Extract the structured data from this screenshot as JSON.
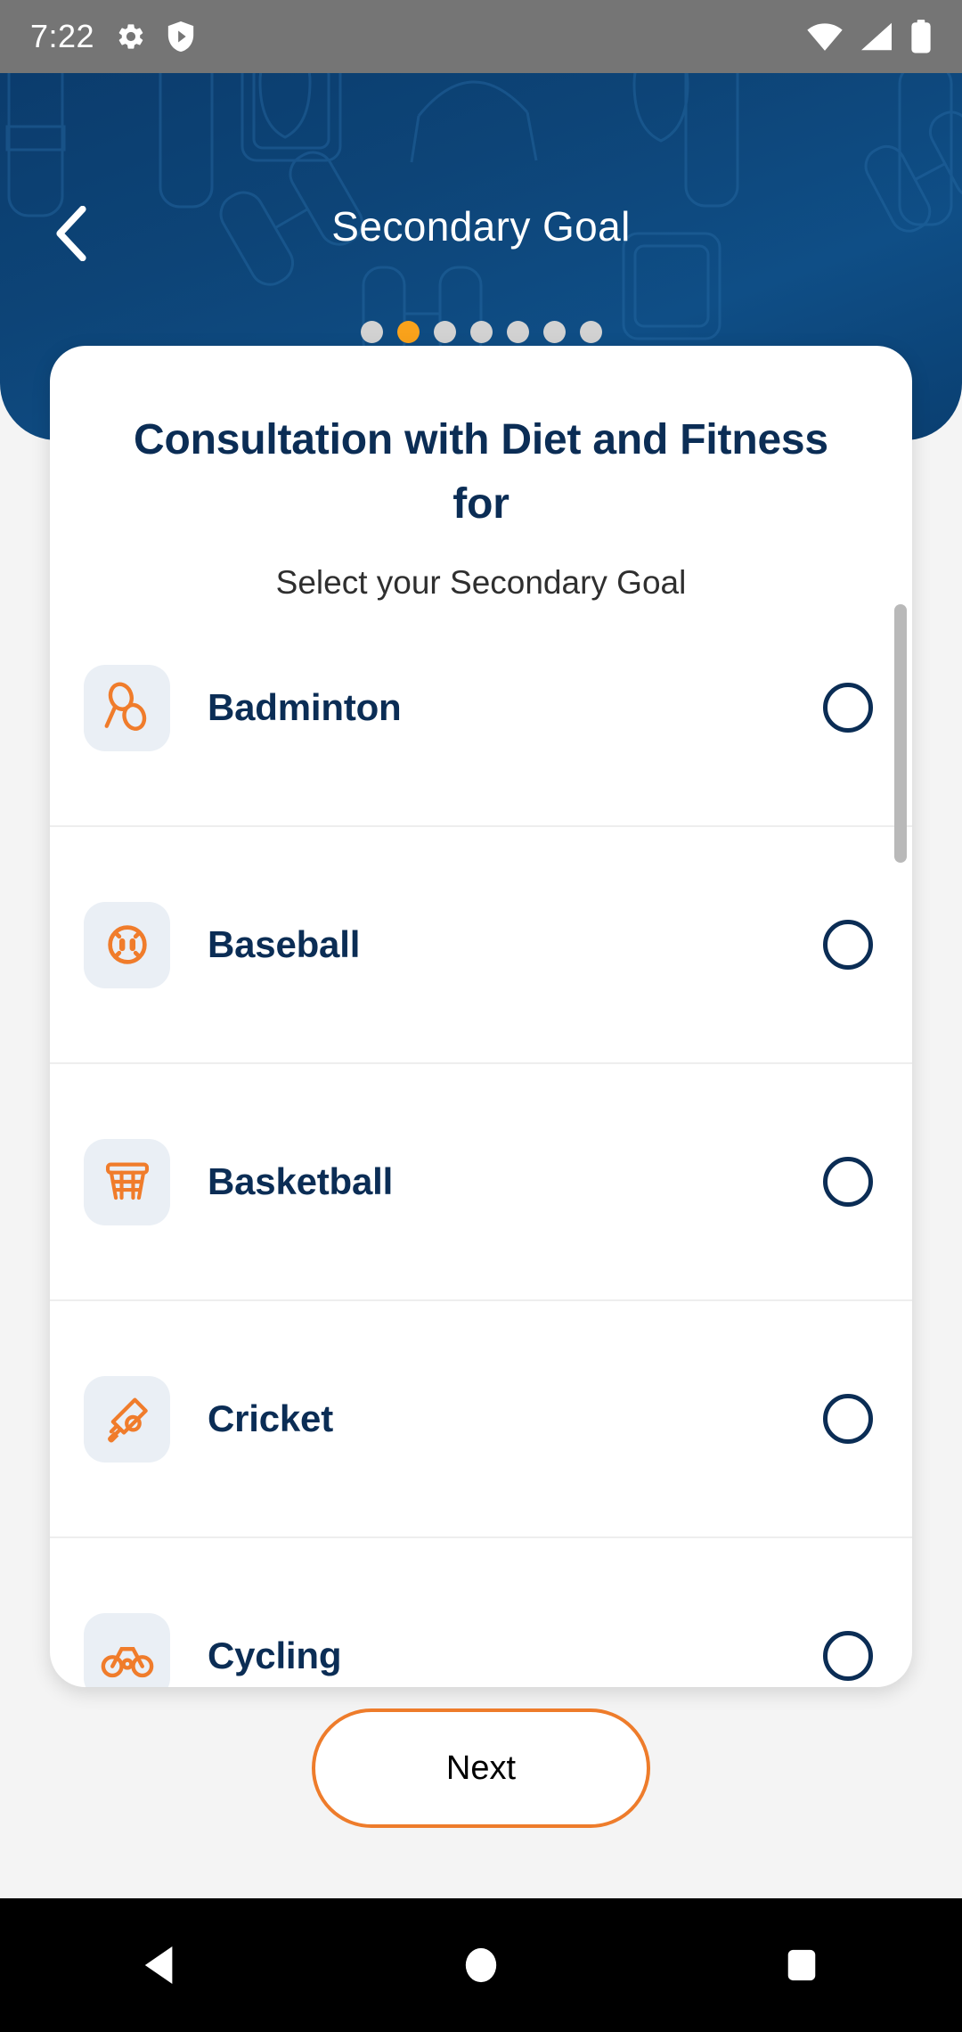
{
  "status_bar": {
    "time": "7:22",
    "icons_left": [
      "gear-icon",
      "shield-play-icon"
    ],
    "icons_right": [
      "wifi-icon",
      "cellular-signal-icon",
      "battery-icon"
    ],
    "background_color": "#757575"
  },
  "header": {
    "title": "Secondary Goal",
    "back_icon": "chevron-left-icon",
    "background_color": "#0d4477",
    "pattern": "fitness-equipment-line-art",
    "pagination": {
      "total": 7,
      "active_index": 1,
      "active_color": "#f9a21b",
      "inactive_color": "#d2d2d2"
    }
  },
  "card": {
    "title": "Consultation with Diet and Fitness for",
    "subtitle": "Select your Secondary Goal",
    "title_color": "#0b2d55",
    "accent_color": "#ee7c2b",
    "options": [
      {
        "label": "Badminton",
        "icon": "badminton-icon",
        "selected": false
      },
      {
        "label": "Baseball",
        "icon": "baseball-icon",
        "selected": false
      },
      {
        "label": "Basketball",
        "icon": "basketball-icon",
        "selected": false
      },
      {
        "label": "Cricket",
        "icon": "cricket-icon",
        "selected": false
      },
      {
        "label": "Cycling",
        "icon": "cycling-icon",
        "selected": false
      }
    ]
  },
  "footer": {
    "next_label": "Next"
  },
  "nav_bar": {
    "back_label": "back-triangle-icon",
    "home_label": "home-circle-icon",
    "recents_label": "recents-square-icon",
    "background_color": "#000000"
  }
}
